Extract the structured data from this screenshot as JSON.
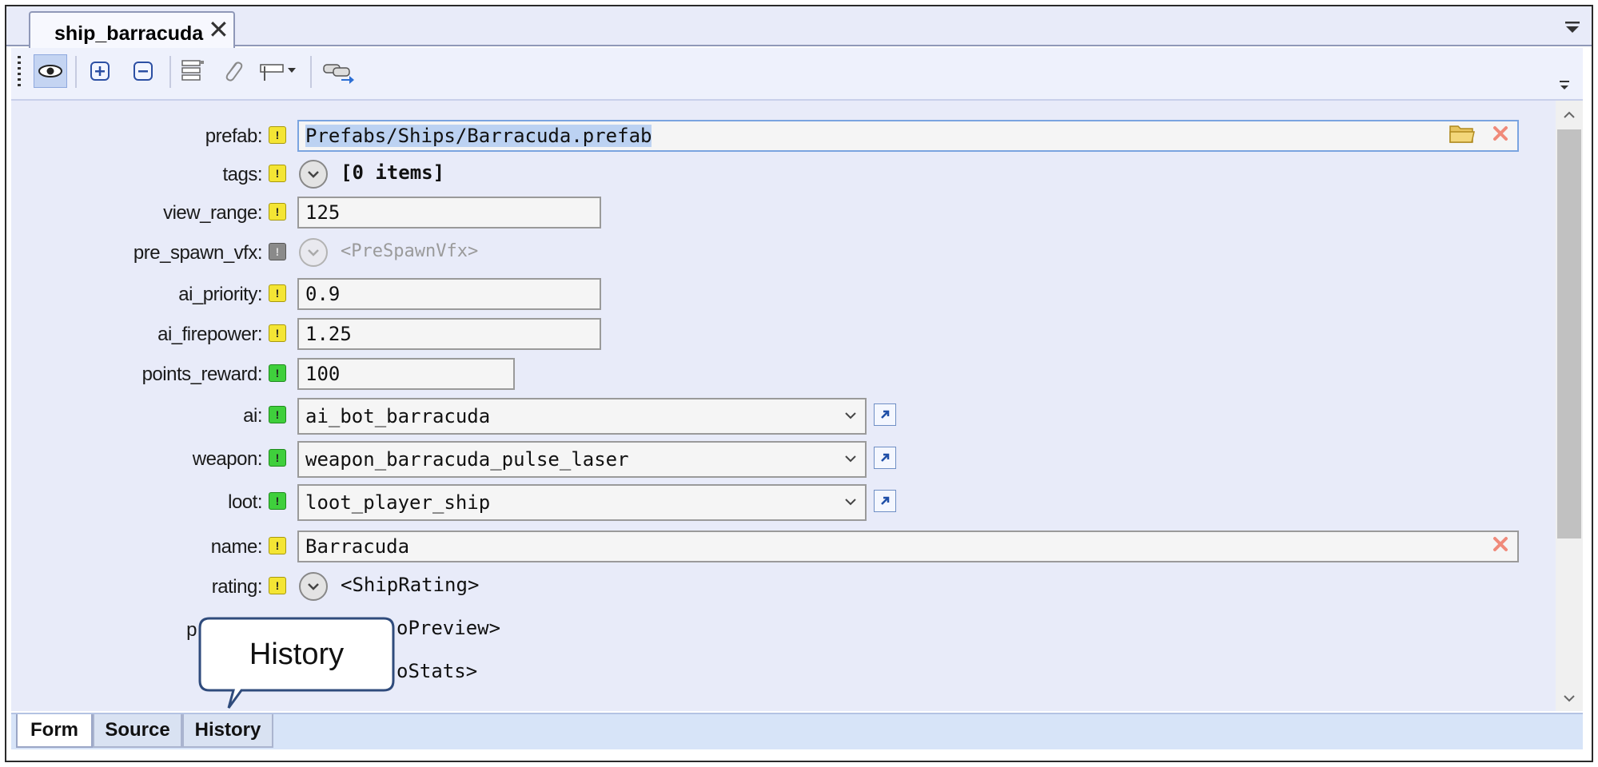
{
  "document_tab": {
    "title": "ship_barracuda",
    "close": "✕"
  },
  "toolbar": {
    "buttons": [
      "eye-icon",
      "plus-icon",
      "minus-icon",
      "layout-icon",
      "paperclip-icon",
      "field-width-icon",
      "link-icon"
    ]
  },
  "fields": [
    {
      "label": "prefab:",
      "flag": "yellow",
      "type": "path",
      "value": "Prefabs/Ships/Barracuda.prefab"
    },
    {
      "label": "tags:",
      "flag": "yellow",
      "type": "list",
      "value": "[0 items]"
    },
    {
      "label": "view_range:",
      "flag": "yellow",
      "type": "number",
      "value": "125"
    },
    {
      "label": "pre_spawn_vfx:",
      "flag": "gray",
      "type": "object-disabled",
      "value": "<PreSpawnVfx>"
    },
    {
      "label": "ai_priority:",
      "flag": "yellow",
      "type": "number",
      "value": "0.9"
    },
    {
      "label": "ai_firepower:",
      "flag": "yellow",
      "type": "number",
      "value": "1.25"
    },
    {
      "label": "points_reward:",
      "flag": "green",
      "type": "number",
      "value": "100"
    },
    {
      "label": "ai:",
      "flag": "green",
      "type": "reference",
      "value": "ai_bot_barracuda"
    },
    {
      "label": "weapon:",
      "flag": "green",
      "type": "reference",
      "value": "weapon_barracuda_pulse_laser"
    },
    {
      "label": "loot:",
      "flag": "green",
      "type": "reference",
      "value": "loot_player_ship"
    },
    {
      "label": "name:",
      "flag": "yellow",
      "type": "string",
      "value": "Barracuda"
    },
    {
      "label": "rating:",
      "flag": "yellow",
      "type": "object",
      "value": "<ShipRating>"
    },
    {
      "label_visible_fragment": "p",
      "type": "object",
      "value_visible_fragment": "oPreview>"
    },
    {
      "type": "object",
      "value_visible_fragment": "oStats>"
    }
  ],
  "bottom_tabs": [
    {
      "label": "Form",
      "active": true
    },
    {
      "label": "Source",
      "active": false
    },
    {
      "label": "History",
      "active": false
    }
  ],
  "callout": {
    "text": "History"
  },
  "colors": {
    "flag_yellow": "#f4e534",
    "flag_green": "#3fcf3c",
    "flag_gray": "#8a8a8a",
    "form_background": "#e8ebf9",
    "selection": "#bcd2f2"
  }
}
